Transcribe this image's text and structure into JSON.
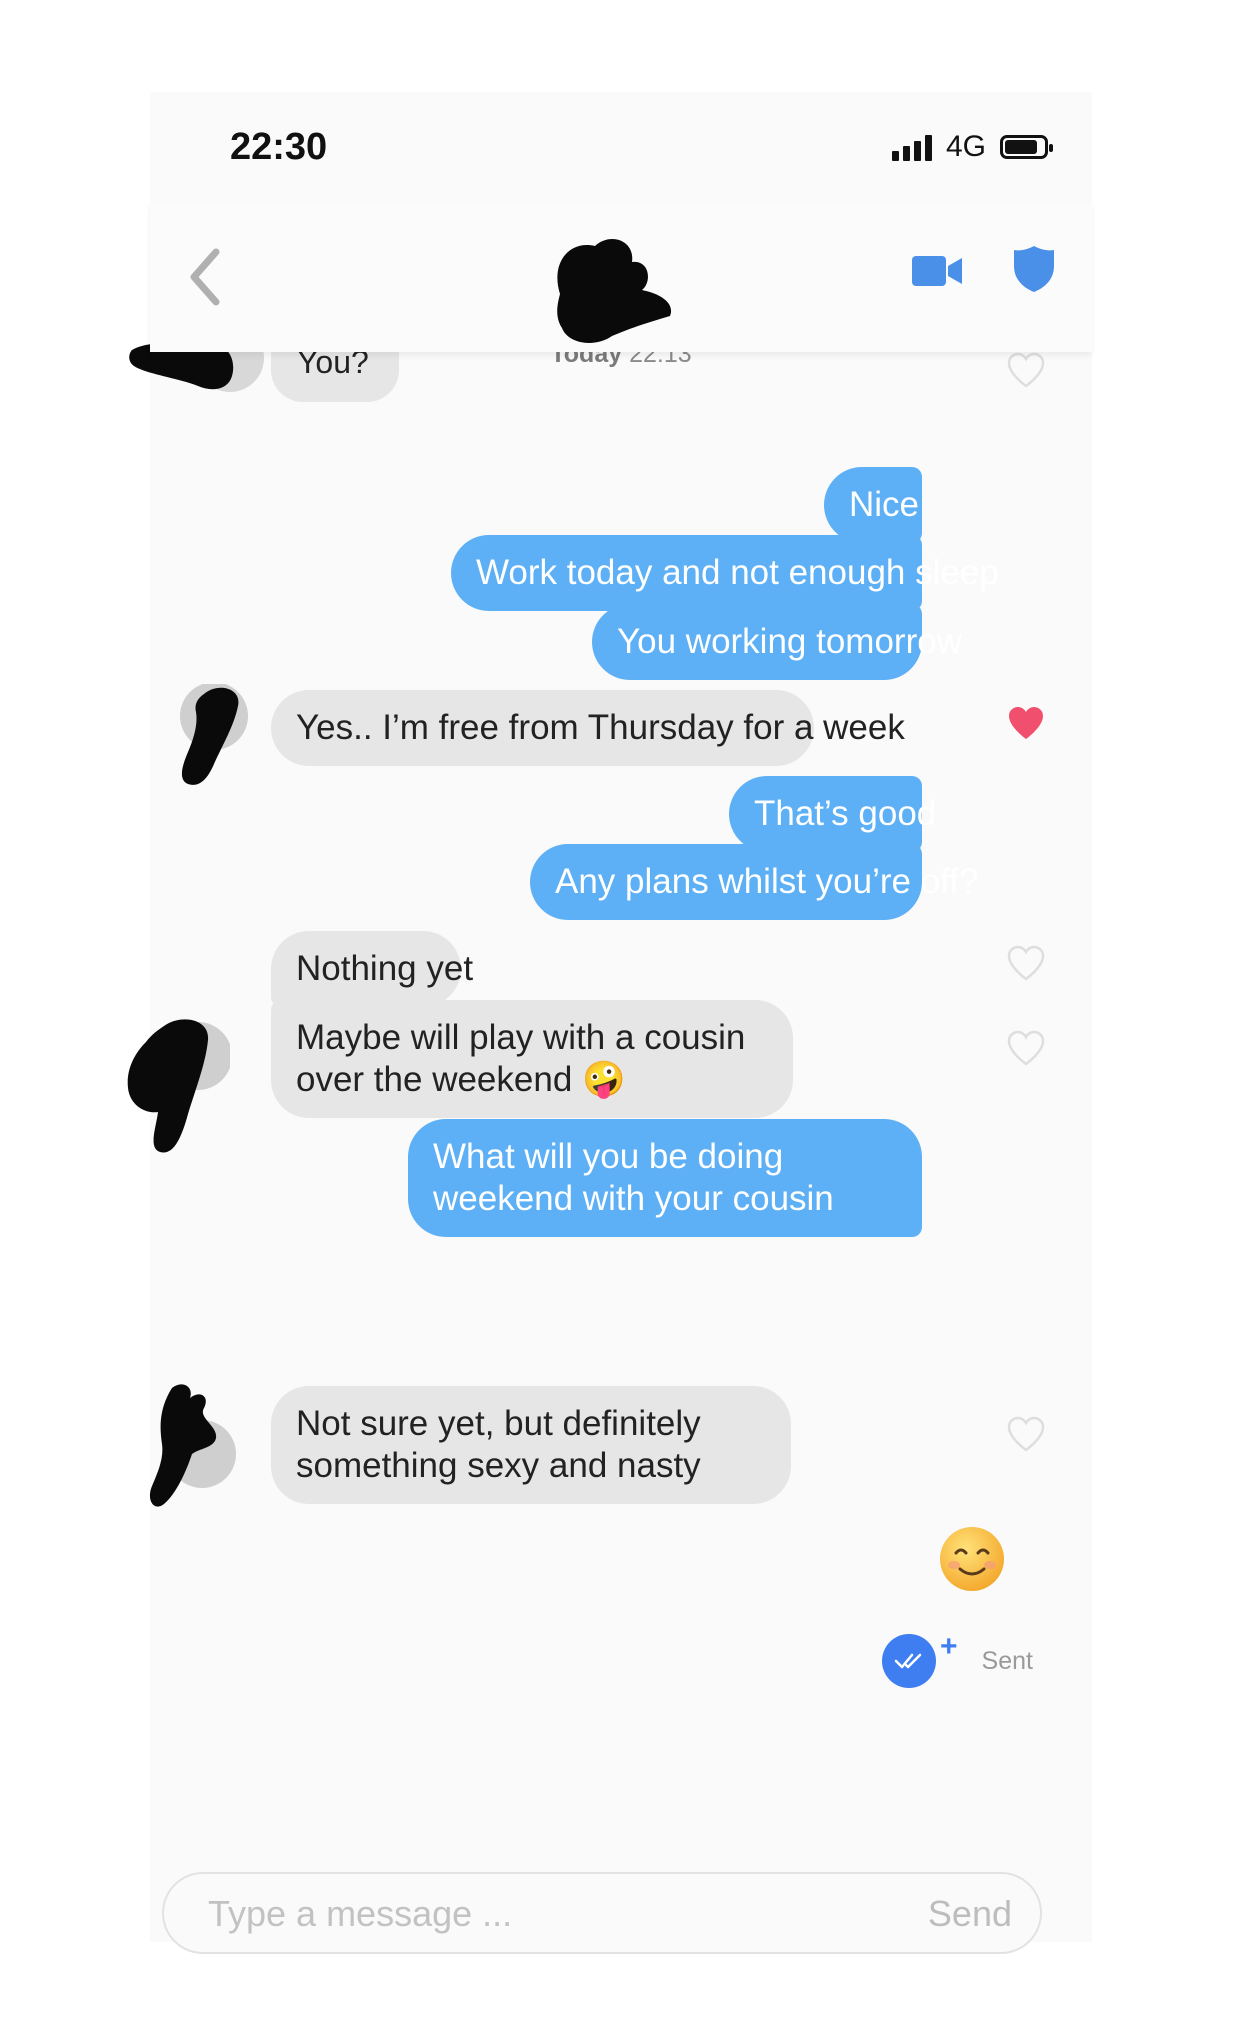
{
  "status_bar": {
    "time": "22:30",
    "network": "4G"
  },
  "header": {
    "video_icon": "video-camera-icon",
    "safety_icon": "shield-icon",
    "back_icon": "chevron-left-icon"
  },
  "partial_message": {
    "text": "You?"
  },
  "timestamp": {
    "day": "Today",
    "time": "22:13"
  },
  "messages": {
    "m1": "Nice",
    "m2": "Work today and not enough sleep",
    "m3": "You working tomorrow",
    "m4": "Yes.. I’m free from Thursday for a week",
    "m5": "That’s good",
    "m6": "Any plans whilst you’re off?",
    "m7": "Nothing yet",
    "m8": "Maybe will play with a cousin over the weekend",
    "m8_emoji": "🤪",
    "m9": "What will you be doing weekend with your cousin",
    "m10_emoji": "😊",
    "m11": "Not sure yet, but definitely something sexy and nasty"
  },
  "receipt": {
    "label": "Sent",
    "plus": "+"
  },
  "composer": {
    "placeholder": "Type a message ...",
    "send_label": "Send"
  },
  "colors": {
    "outgoing": "#5db0f5",
    "incoming": "#e6e6e6",
    "liked": "#f0506e",
    "accent": "#3f7ef0"
  }
}
